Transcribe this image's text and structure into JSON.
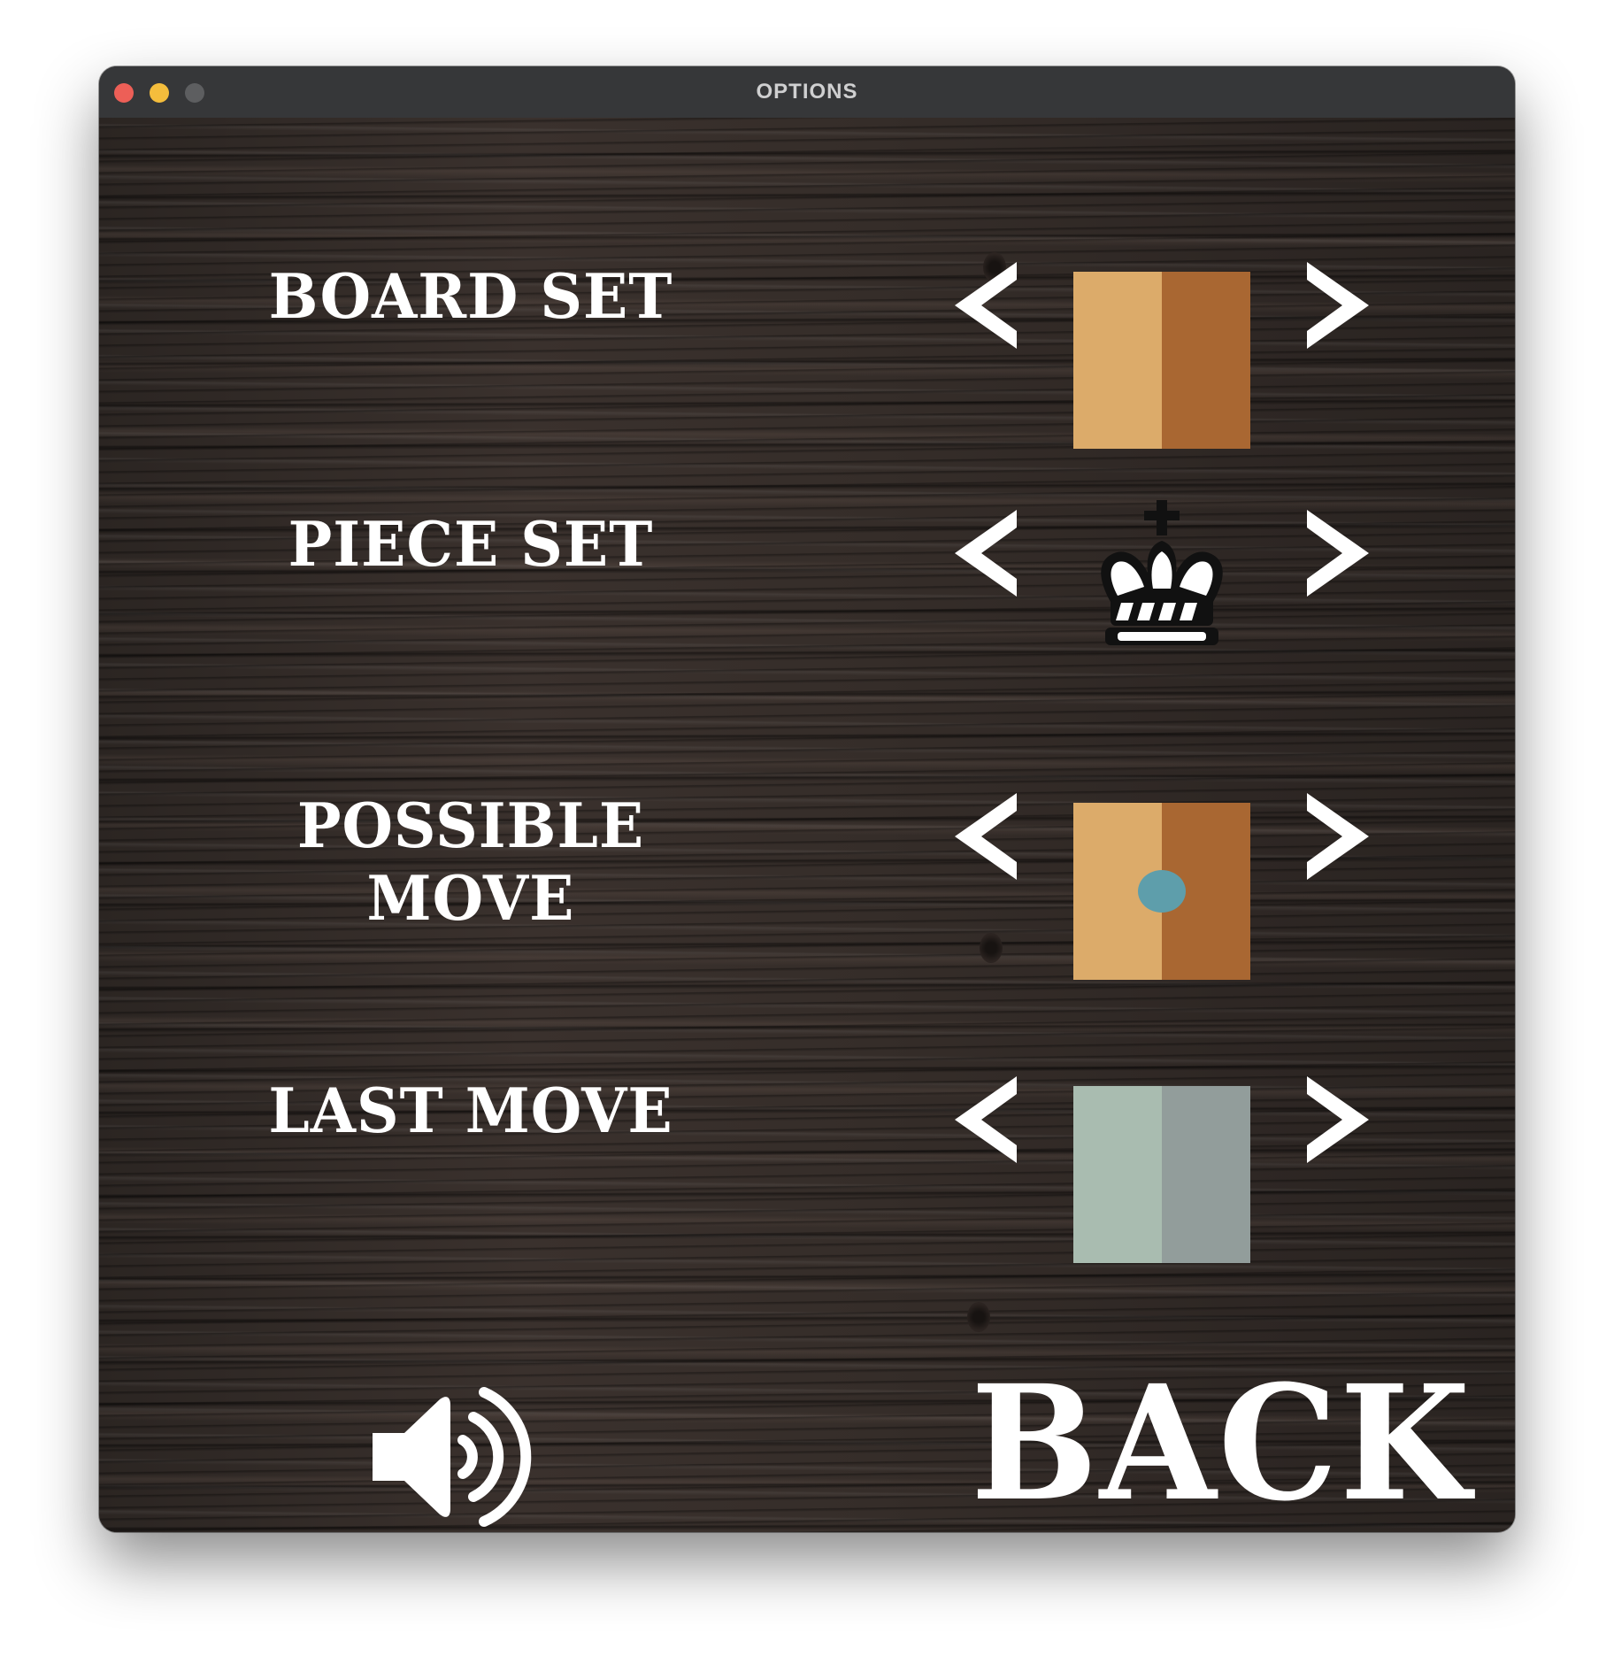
{
  "window": {
    "title": "OPTIONS"
  },
  "options": [
    {
      "label": "BOARD SET",
      "type": "board",
      "colors": [
        "#dcab6a",
        "#a96732"
      ]
    },
    {
      "label": "PIECE SET",
      "type": "piece",
      "icon": "white-king-crown-icon"
    },
    {
      "label": "POSSIBLE MOVE",
      "type": "board-dot",
      "colors": [
        "#dcab6a",
        "#a96732"
      ],
      "dot_color": "#5e9eab"
    },
    {
      "label": "LAST MOVE",
      "type": "board",
      "colors": [
        "#a9bcb0",
        "#929d9b"
      ]
    }
  ],
  "controls": {
    "sound_icon": "speaker-on-icon",
    "back_label": "BACK"
  }
}
